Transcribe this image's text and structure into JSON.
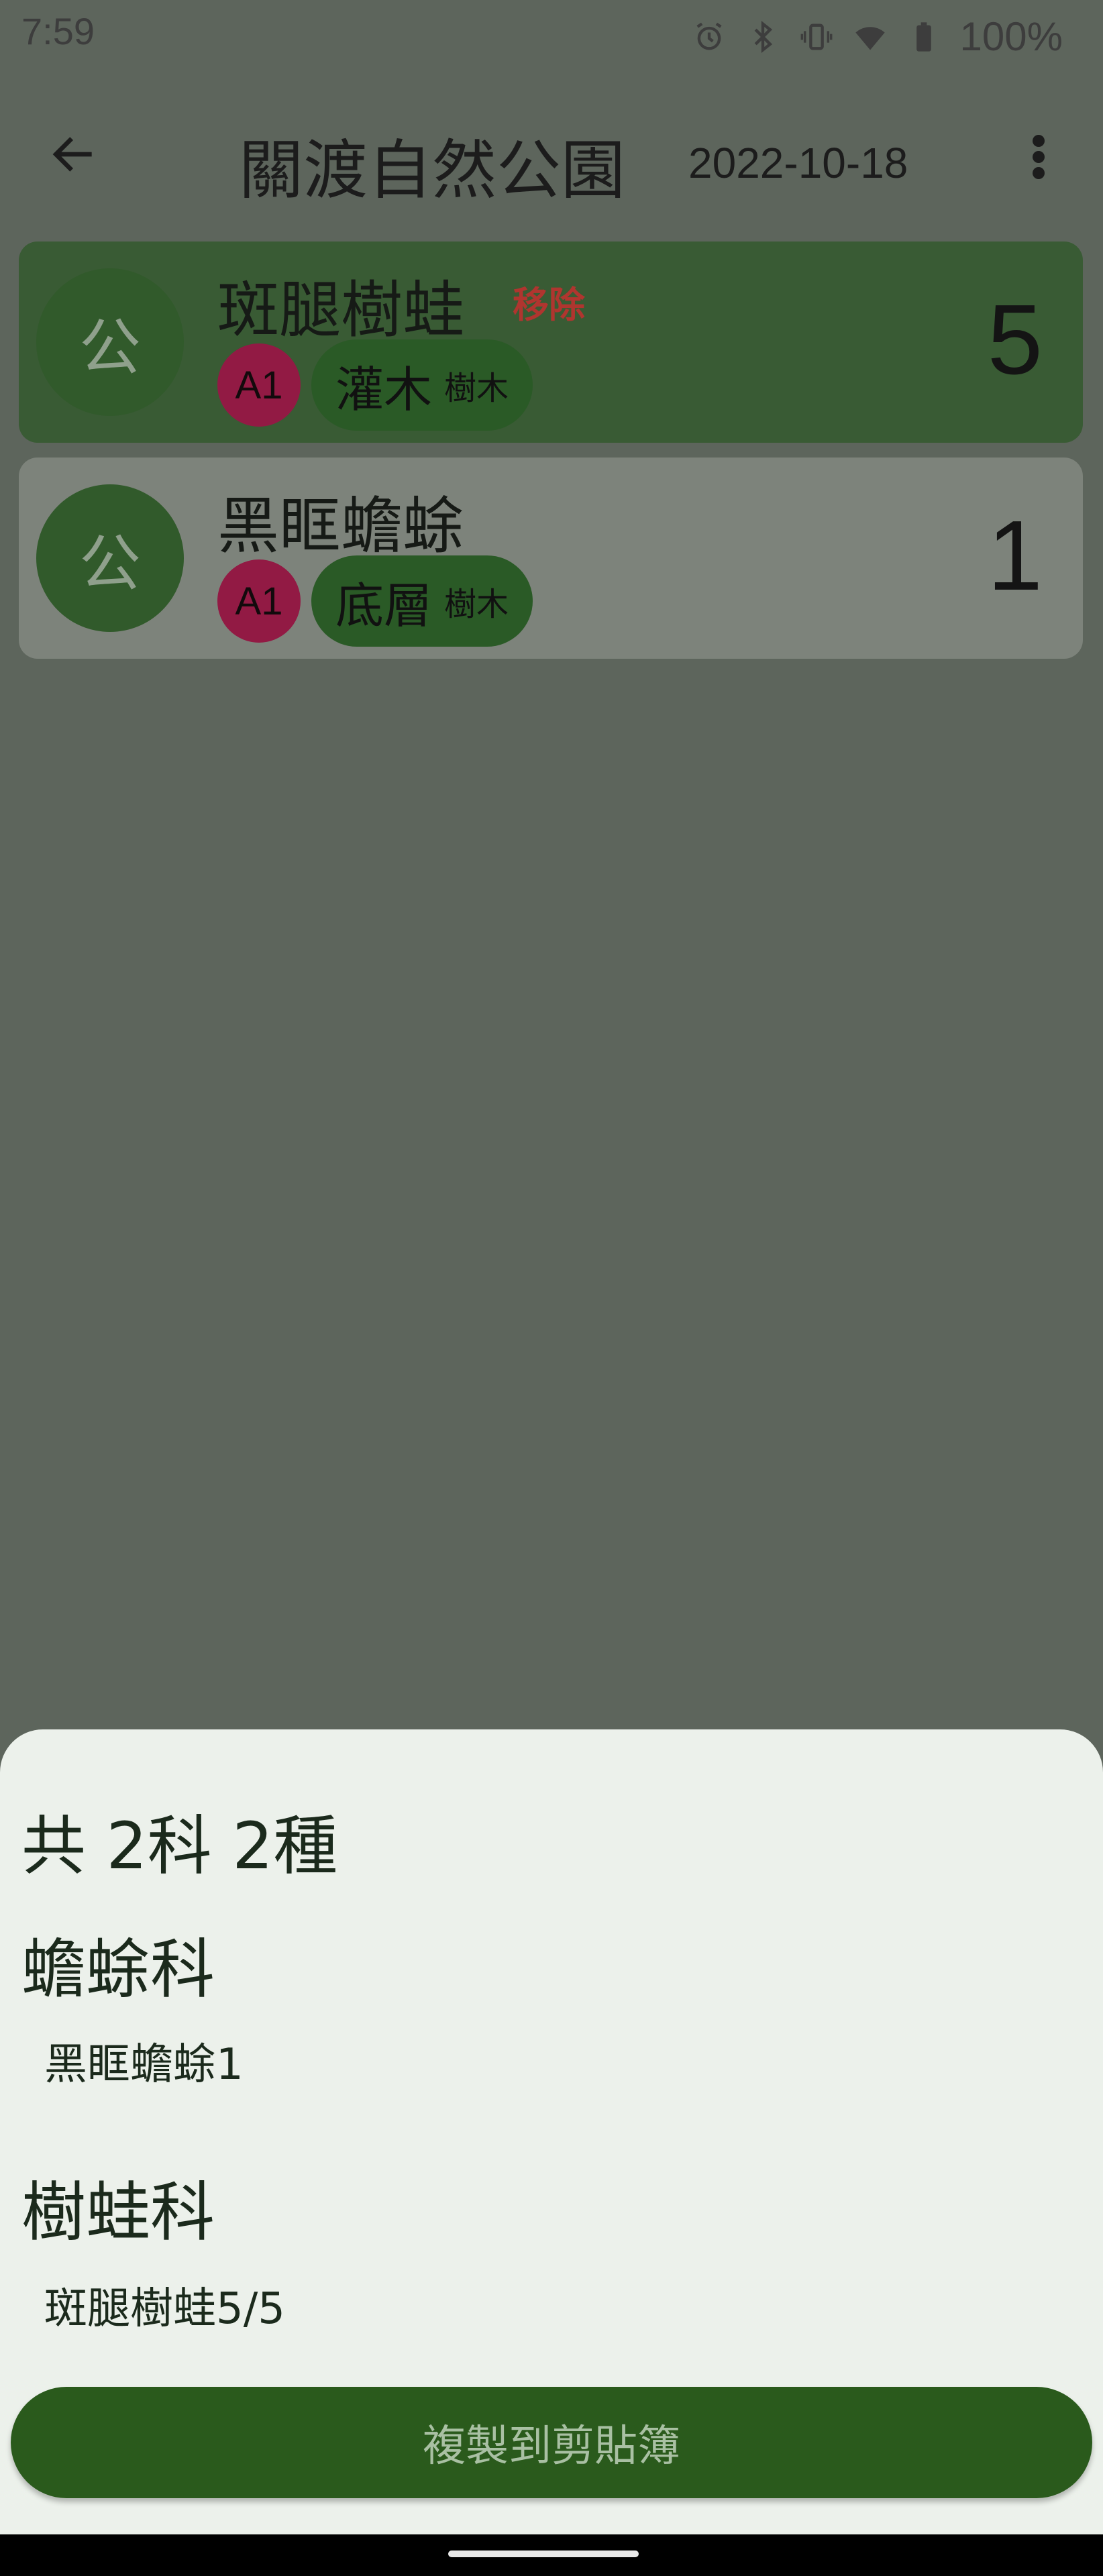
{
  "status_bar": {
    "time": "7:59",
    "battery": "100%",
    "icons": [
      "alarm-icon",
      "bluetooth-icon",
      "vibrate-icon",
      "wifi-icon",
      "battery-icon"
    ]
  },
  "app_bar": {
    "back_icon": "arrow-left-icon",
    "title": "關渡自然公園",
    "date": "2022-10-18",
    "more_icon": "more-vertical-icon"
  },
  "records": [
    {
      "avatar": "公",
      "name": "斑腿樹蛙",
      "remove_label": "移除",
      "zone": "A1",
      "layer": "灌木",
      "layer_sub": "樹木",
      "count": "5"
    },
    {
      "avatar": "公",
      "name": "黑眶蟾蜍",
      "zone": "A1",
      "layer": "底層",
      "layer_sub": "樹木",
      "count": "1"
    }
  ],
  "sheet": {
    "summary": "共 2科 2種",
    "families": [
      {
        "name": "蟾蜍科",
        "items": [
          "黑眶蟾蜍1"
        ]
      },
      {
        "name": "樹蛙科",
        "items": [
          "斑腿樹蛙5/5"
        ]
      }
    ],
    "copy_button": "複製到剪貼簿"
  },
  "colors": {
    "scrim_background": "#5d655c",
    "card_selected": "#395b34",
    "card_default": "#7d837b",
    "avatar": "#315a2b",
    "zone_badge": "#921a44",
    "layer_chip": "#2a5a26",
    "remove_text": "#b0352f",
    "sheet_background": "#ecf1eb",
    "primary_button": "#2a5a1c"
  }
}
